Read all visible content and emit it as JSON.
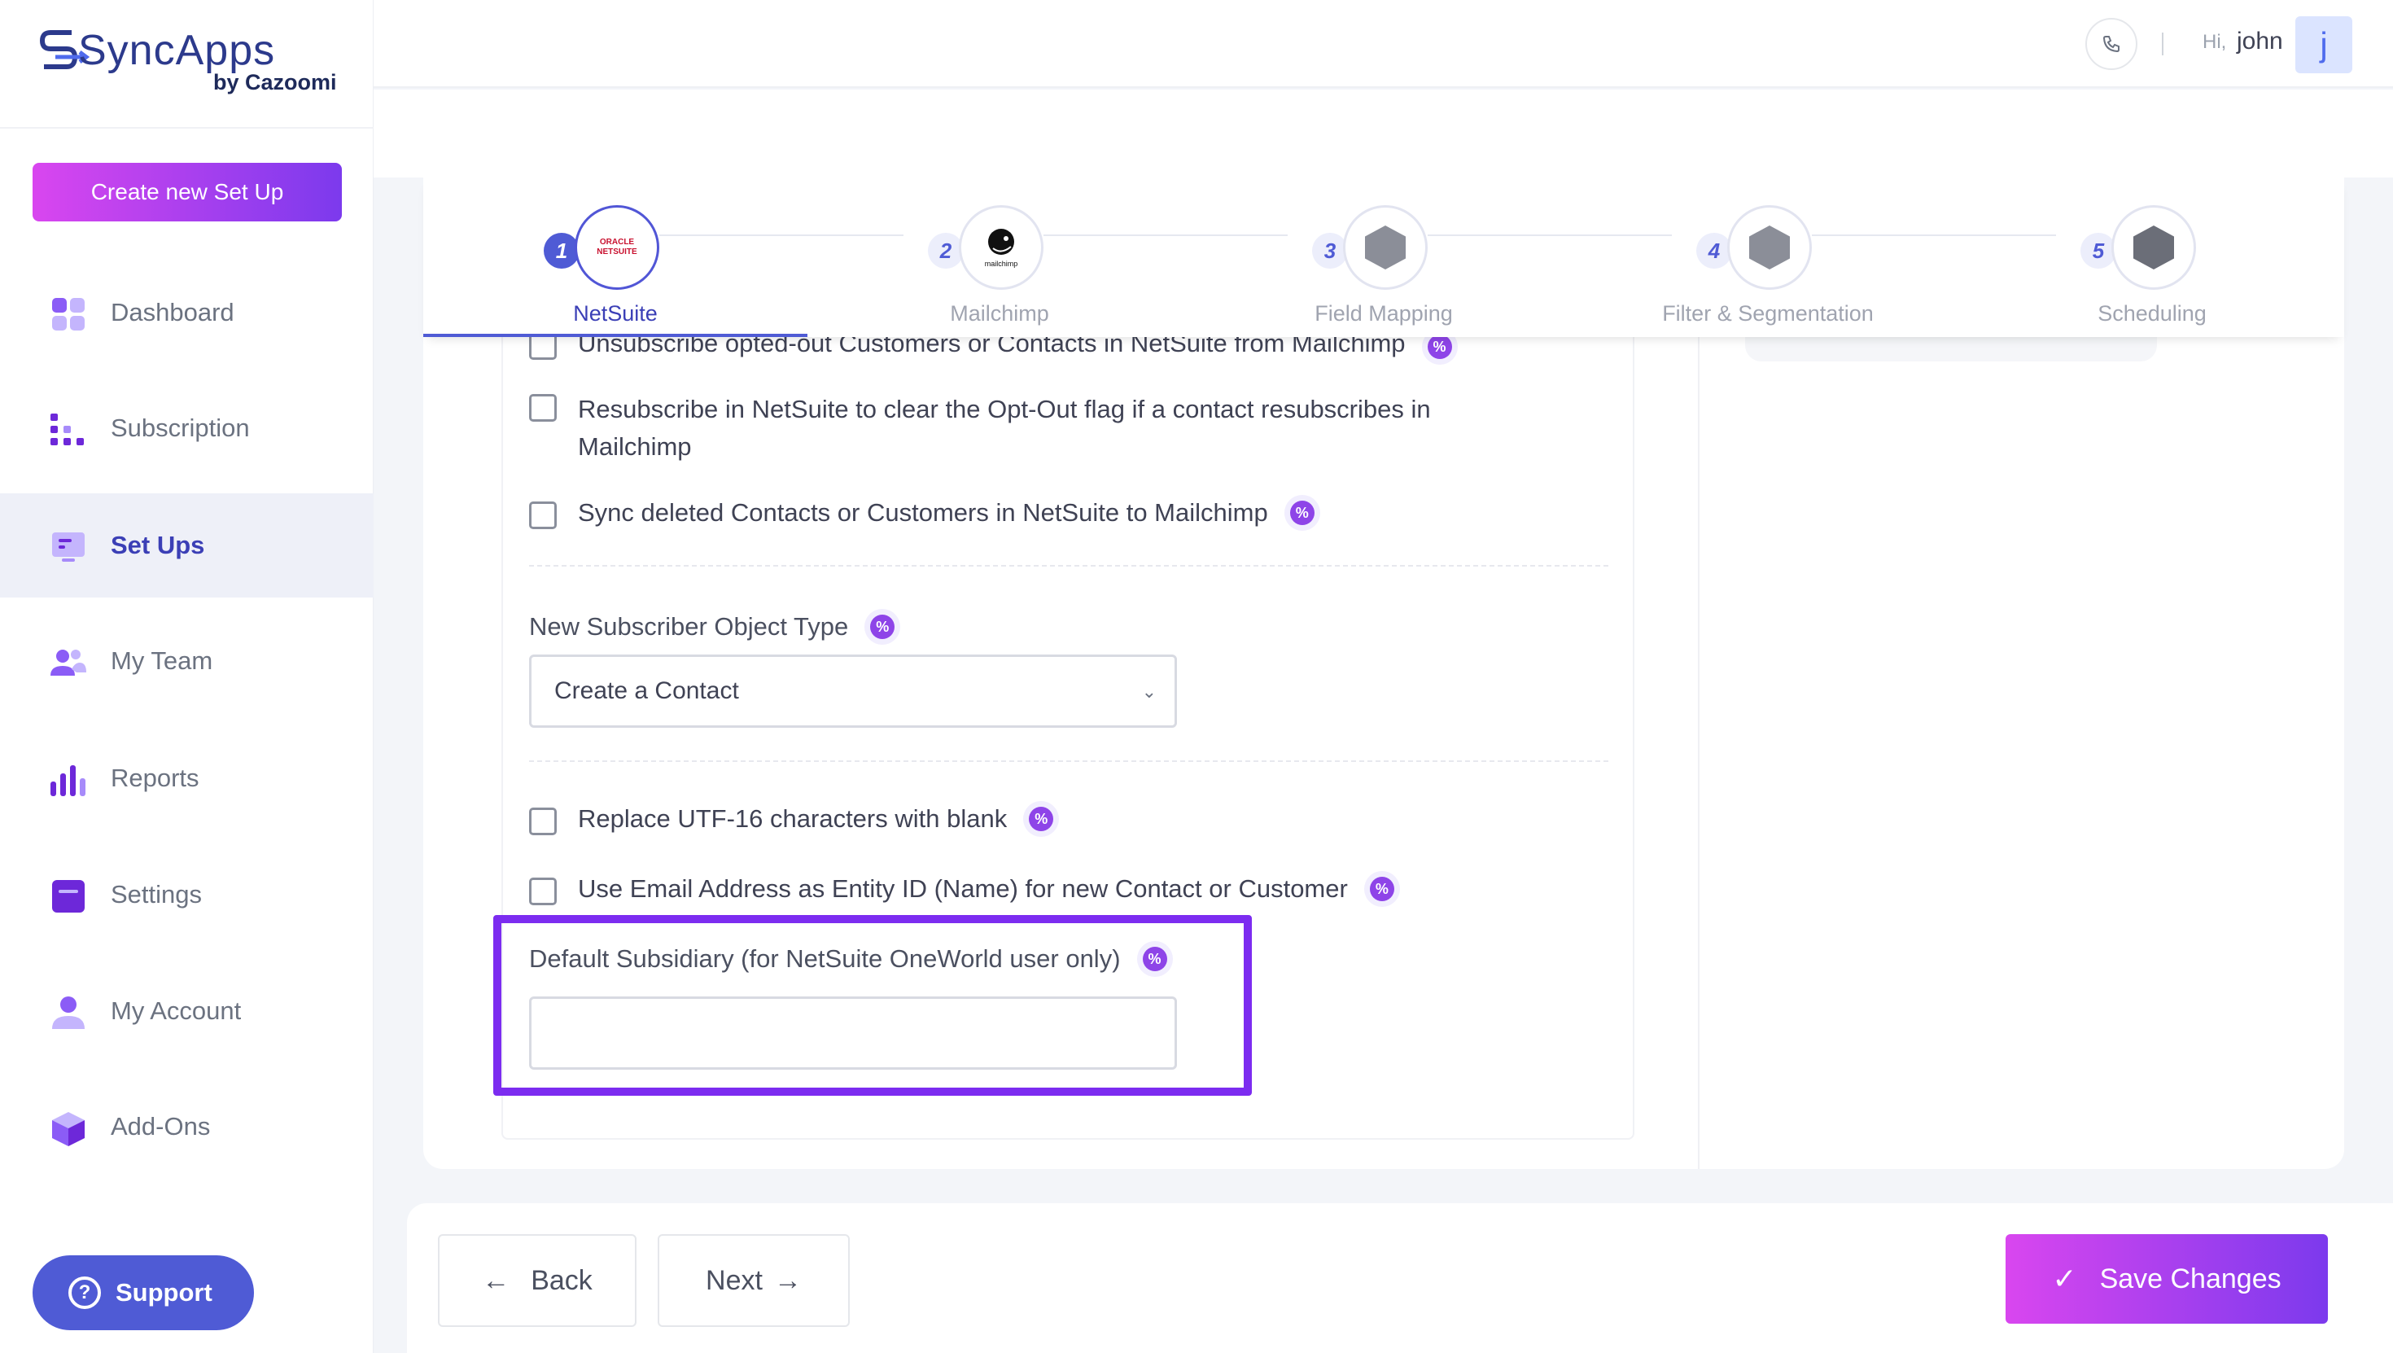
{
  "brand": {
    "name": "SyncApps",
    "sub": "by Cazoomi"
  },
  "sidebar": {
    "create_label": "Create new Set Up",
    "items": [
      {
        "label": "Dashboard",
        "icon": "dashboard-icon"
      },
      {
        "label": "Subscription",
        "icon": "subscription-icon"
      },
      {
        "label": "Set Ups",
        "icon": "setups-icon",
        "active": true
      },
      {
        "label": "My Team",
        "icon": "team-icon"
      },
      {
        "label": "Reports",
        "icon": "reports-icon"
      },
      {
        "label": "Settings",
        "icon": "settings-icon"
      },
      {
        "label": "My Account",
        "icon": "account-icon"
      },
      {
        "label": "Add-Ons",
        "icon": "addons-icon"
      }
    ],
    "support_label": "Support"
  },
  "header": {
    "hi": "Hi,",
    "user": "john",
    "avatar_letter": "j"
  },
  "stepper": {
    "steps": [
      {
        "num": "1",
        "label": "NetSuite",
        "logo": "ORACLE NETSUITE"
      },
      {
        "num": "2",
        "label": "Mailchimp",
        "logo": "mailchimp"
      },
      {
        "num": "3",
        "label": "Field Mapping"
      },
      {
        "num": "4",
        "label": "Filter & Segmentation"
      },
      {
        "num": "5",
        "label": "Scheduling"
      }
    ]
  },
  "form": {
    "opt_unsub": "Unsubscribe opted-out Customers or Contacts in NetSuite from Mailchimp",
    "opt_resub_1": "Resubscribe in NetSuite to clear the Opt-Out flag if a contact resubscribes in",
    "opt_resub_2": "Mailchimp",
    "opt_sync_deleted": "Sync deleted Contacts or Customers in NetSuite to Mailchimp",
    "new_sub_label": "New Subscriber Object Type",
    "new_sub_value": "Create a Contact",
    "opt_utf16": "Replace UTF-16 characters with blank",
    "opt_email_id": "Use Email Address as Entity ID (Name) for new Contact or Customer",
    "subsidiary_label": "Default Subsidiary (for NetSuite OneWorld user only)",
    "subsidiary_value": ""
  },
  "footer": {
    "back": "Back",
    "next": "Next",
    "save": "Save Changes"
  }
}
